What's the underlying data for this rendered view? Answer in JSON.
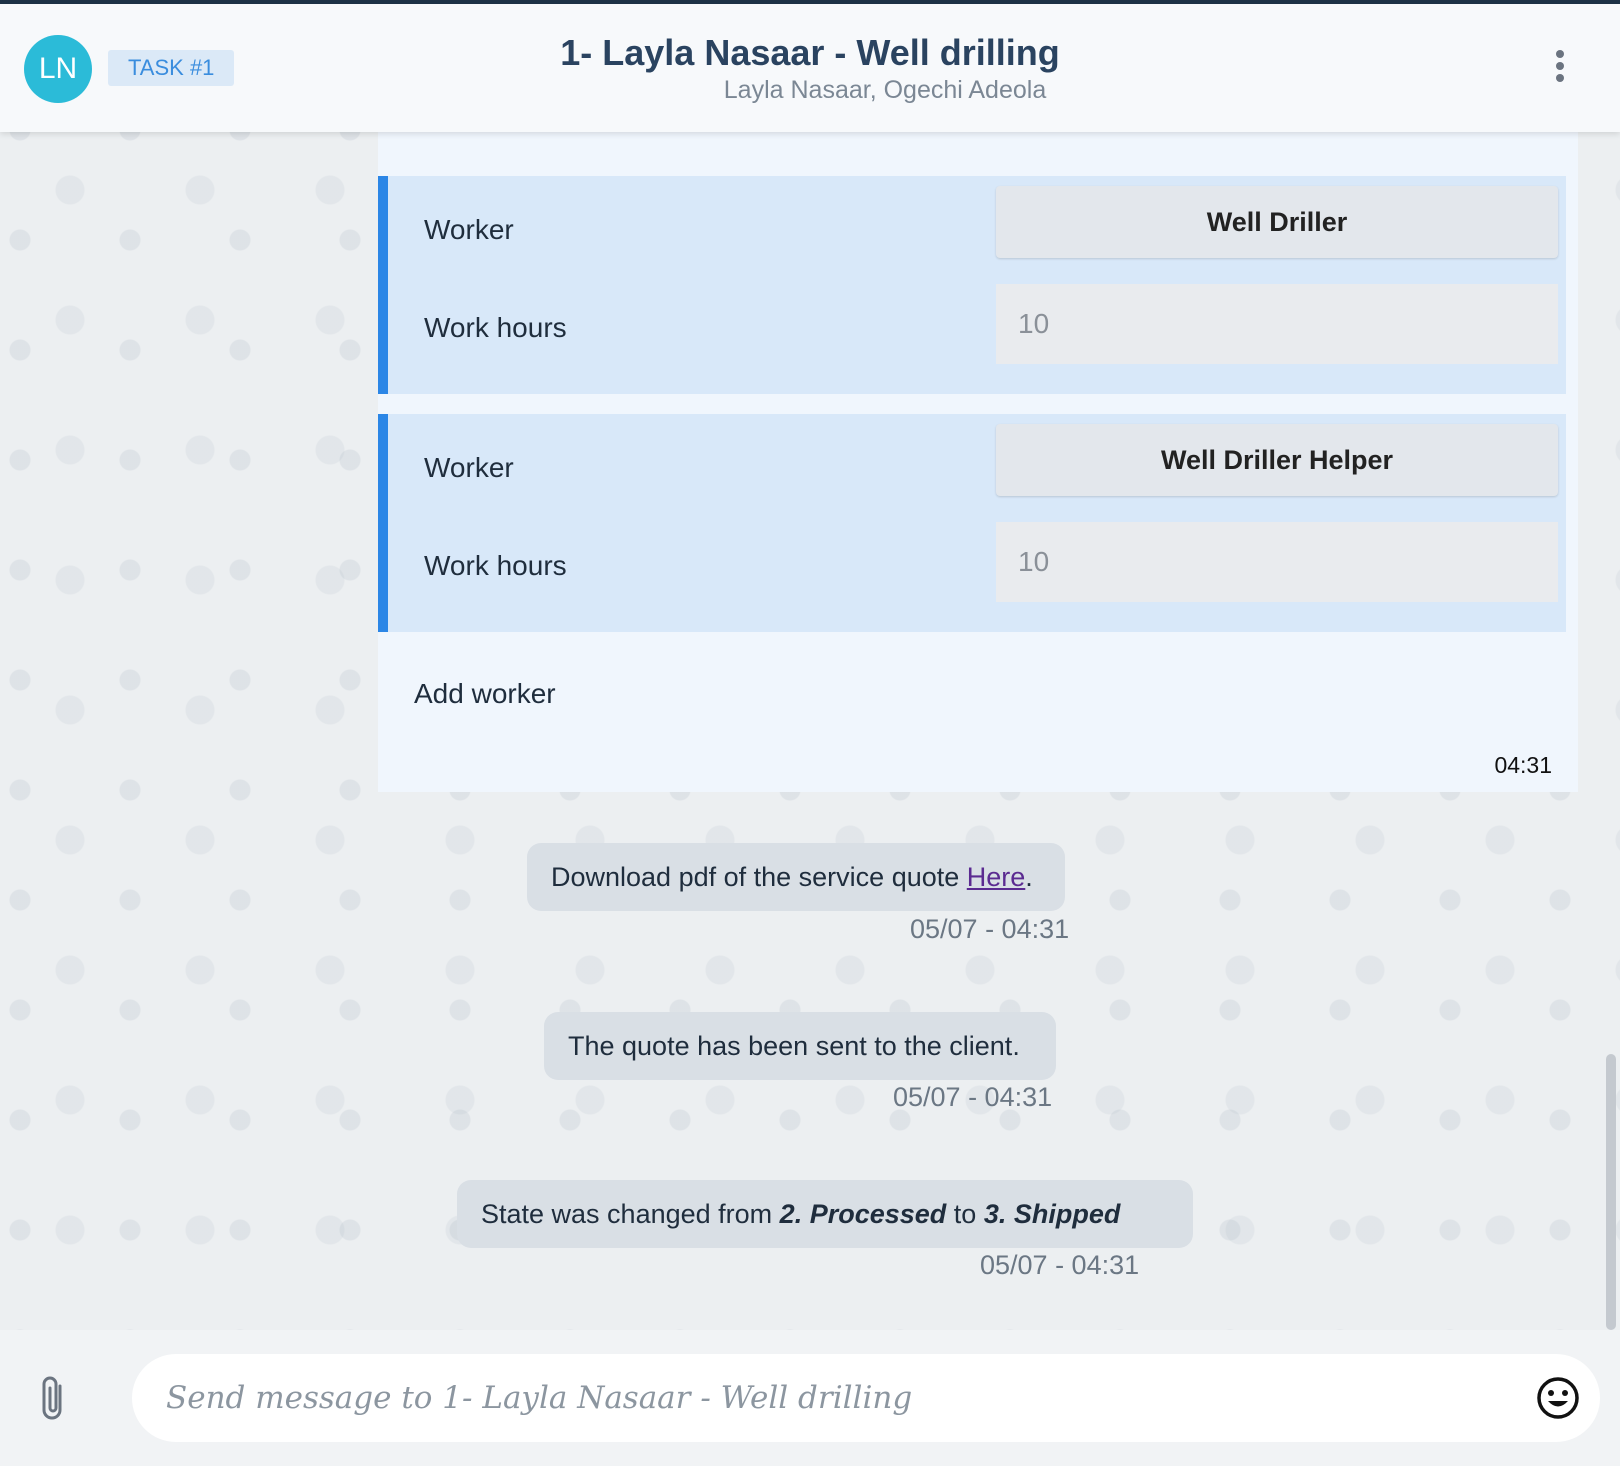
{
  "header": {
    "avatar_initials": "LN",
    "task_badge": "TASK #1",
    "title": "1- Layla Nasaar - Well drilling",
    "subtitle": "Layla Nasaar, Ogechi Adeola"
  },
  "card": {
    "workers": [
      {
        "worker_label": "Worker",
        "worker_value": "Well Driller",
        "hours_label": "Work hours",
        "hours_value": "10"
      },
      {
        "worker_label": "Worker",
        "worker_value": "Well Driller Helper",
        "hours_label": "Work hours",
        "hours_value": "10"
      }
    ],
    "add_worker": "Add worker",
    "time": "04:31"
  },
  "messages": [
    {
      "text_before": "Download pdf of the service quote ",
      "link_text": "Here",
      "text_after": ".",
      "timestamp": "05/07 - 04:31"
    },
    {
      "text": "The quote has been sent to the client.",
      "timestamp": "05/07 - 04:31"
    },
    {
      "text_before": "State was changed from ",
      "from_state": "2. Processed",
      "middle": " to ",
      "to_state": "3. Shipped",
      "timestamp": "05/07 - 04:31"
    }
  ],
  "composer": {
    "placeholder": "Send message to 1- Layla Nasaar - Well drilling"
  },
  "colors": {
    "accent": "#2b86e6",
    "avatar": "#2bbbd8",
    "header_title": "#2a4360"
  }
}
